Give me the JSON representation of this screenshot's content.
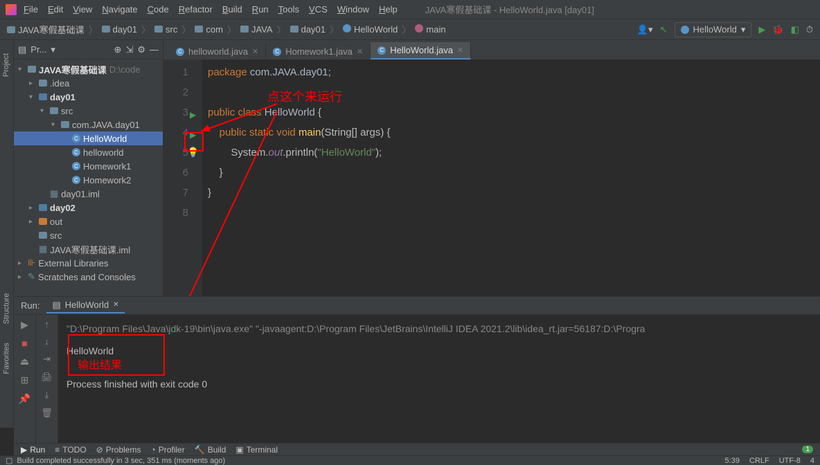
{
  "titlebar": {
    "menu": [
      "File",
      "Edit",
      "View",
      "Navigate",
      "Code",
      "Refactor",
      "Build",
      "Run",
      "Tools",
      "VCS",
      "Window",
      "Help"
    ],
    "title": "JAVA寒假基础课 - HelloWorld.java [day01]"
  },
  "breadcrumb": [
    "JAVA寒假基础课",
    "day01",
    "src",
    "com",
    "JAVA",
    "day01",
    "HelloWorld",
    "main"
  ],
  "run_config": "HelloWorld",
  "project": {
    "header": "Pr...",
    "root": "JAVA寒假基础课",
    "root_path": "D:\\code",
    "tree": [
      {
        "d": 1,
        "t": "folder",
        "l": ".idea",
        "exp": false
      },
      {
        "d": 1,
        "t": "module",
        "l": "day01",
        "exp": true,
        "bold": true
      },
      {
        "d": 2,
        "t": "folder",
        "l": "src",
        "exp": true
      },
      {
        "d": 3,
        "t": "package",
        "l": "com.JAVA.day01",
        "exp": true
      },
      {
        "d": 4,
        "t": "class",
        "l": "HelloWorld",
        "sel": true
      },
      {
        "d": 4,
        "t": "class",
        "l": "helloworld"
      },
      {
        "d": 4,
        "t": "class",
        "l": "Homework1"
      },
      {
        "d": 4,
        "t": "class",
        "l": "Homework2"
      },
      {
        "d": 2,
        "t": "file",
        "l": "day01.iml"
      },
      {
        "d": 1,
        "t": "module",
        "l": "day02",
        "exp": false,
        "bold": true
      },
      {
        "d": 1,
        "t": "folder-o",
        "l": "out",
        "exp": false
      },
      {
        "d": 1,
        "t": "folder",
        "l": "src"
      },
      {
        "d": 1,
        "t": "file",
        "l": "JAVA寒假基础课.iml"
      },
      {
        "d": 0,
        "t": "lib",
        "l": "External Libraries",
        "exp": false
      },
      {
        "d": 0,
        "t": "scratch",
        "l": "Scratches and Consoles",
        "exp": false
      }
    ]
  },
  "tabs": [
    {
      "label": "helloworld.java",
      "active": false
    },
    {
      "label": "Homework1.java",
      "active": false
    },
    {
      "label": "HelloWorld.java",
      "active": true
    }
  ],
  "code": {
    "lines": [
      {
        "n": 1,
        "html": "<span class='kw'>package</span> <span class='pk'>com.JAVA.day01</span>;"
      },
      {
        "n": 2,
        "html": ""
      },
      {
        "n": 3,
        "html": "<span class='kw'>public</span> <span class='kw'>class</span> <span class='cls'>HelloWorld</span> {",
        "run": true
      },
      {
        "n": 4,
        "html": "    <span class='kw'>public</span> <span class='kw'>static</span> <span class='kw'>void</span> <span class='mthd'>main</span>(String[] args) {",
        "run": true,
        "box": true
      },
      {
        "n": 5,
        "html": "        System.<span class='fld'>out</span>.println(<span class='str'>\"HelloWorld\"</span>);",
        "bulb": true
      },
      {
        "n": 6,
        "html": "    }"
      },
      {
        "n": 7,
        "html": "}"
      },
      {
        "n": 8,
        "html": ""
      }
    ]
  },
  "annotations": {
    "run_label": "点这个来运行",
    "output_label": "输出结果"
  },
  "run": {
    "label": "Run:",
    "tab": "HelloWorld",
    "cmd": "\"D:\\Program Files\\Java\\jdk-19\\bin\\java.exe\" \"-javaagent:D:\\Program Files\\JetBrains\\IntelliJ IDEA 2021.2\\lib\\idea_rt.jar=56187:D:\\Progra",
    "out": "HelloWorld",
    "exit": "Process finished with exit code 0"
  },
  "bottom_tabs": [
    "Run",
    "TODO",
    "Problems",
    "Profiler",
    "Build",
    "Terminal"
  ],
  "status": {
    "left": "Build completed successfully in 3 sec, 351 ms (moments ago)",
    "pos": "5:39",
    "eol": "CRLF",
    "enc": "UTF-8",
    "sp": "4"
  },
  "side_tabs": [
    "Project",
    "Structure",
    "Favorites"
  ]
}
